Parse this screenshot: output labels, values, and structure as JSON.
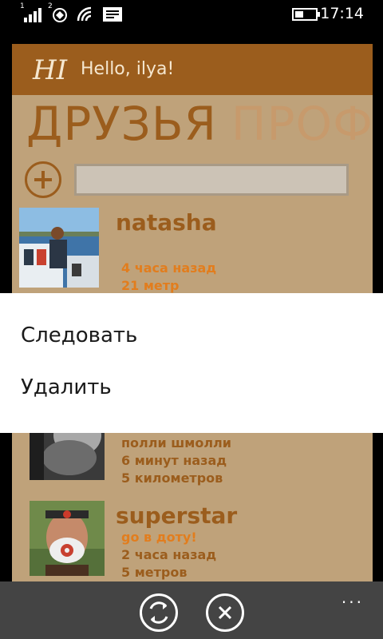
{
  "status_bar": {
    "signal_sup": "1",
    "sim2_sup": "2",
    "time": "17:14",
    "icons": [
      "signal-icon",
      "sim2-signal-icon",
      "wifi-icon",
      "message-icon",
      "battery-icon"
    ]
  },
  "header": {
    "logo": "HI",
    "greeting": "Hello, ilya!"
  },
  "pivot": {
    "active": "ДРУЗЬЯ",
    "inactive": "ПРОФ"
  },
  "search": {
    "value": "",
    "placeholder": ""
  },
  "friends": [
    {
      "name": "natasha",
      "status": "",
      "time": "4 часа назад",
      "distance": "21 метр"
    },
    {
      "name": "",
      "status": "полли шмолли",
      "time": "6 минут назад",
      "distance": "5 километров"
    },
    {
      "name": "superstar",
      "status": "go в доту!",
      "time": "2 часа назад",
      "distance": "5 метров"
    }
  ],
  "context_menu": {
    "follow": "Следовать",
    "delete": "Удалить"
  },
  "app_bar": {
    "buttons": [
      "refresh-icon",
      "close-icon"
    ],
    "more": "..."
  },
  "colors": {
    "accent": "#9b5d1d",
    "background": "#bfa27a",
    "status_orange": "#e27d1d",
    "inactive_pivot": "#c79a6c"
  }
}
